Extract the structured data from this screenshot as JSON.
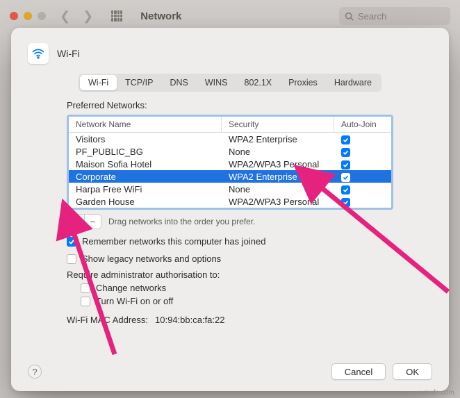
{
  "bg": {
    "title": "Network",
    "search_placeholder": "Search"
  },
  "sheet": {
    "title": "Wi-Fi"
  },
  "tabs": [
    "Wi-Fi",
    "TCP/IP",
    "DNS",
    "WINS",
    "802.1X",
    "Proxies",
    "Hardware"
  ],
  "active_tab": 0,
  "section_label": "Preferred Networks:",
  "columns": {
    "name": "Network Name",
    "security": "Security",
    "autojoin": "Auto-Join"
  },
  "networks": [
    {
      "name": "Visitors",
      "security": "WPA2 Enterprise",
      "autojoin": true,
      "selected": false
    },
    {
      "name": "PF_PUBLIC_BG",
      "security": "None",
      "autojoin": true,
      "selected": false
    },
    {
      "name": "Maison Sofia Hotel",
      "security": "WPA2/WPA3 Personal",
      "autojoin": true,
      "selected": false
    },
    {
      "name": "Corporate",
      "security": "WPA2 Enterprise",
      "autojoin": true,
      "selected": true
    },
    {
      "name": "Harpa Free WiFi",
      "security": "None",
      "autojoin": true,
      "selected": false
    },
    {
      "name": "Garden House",
      "security": "WPA2/WPA3 Personal",
      "autojoin": true,
      "selected": false
    }
  ],
  "drag_hint": "Drag networks into the order you prefer.",
  "options": {
    "remember": {
      "label": "Remember networks this computer has joined",
      "checked": true
    },
    "show_legacy": {
      "label": "Show legacy networks and options",
      "checked": false
    },
    "require_label": "Require administrator authorisation to:",
    "change_networks": {
      "label": "Change networks",
      "checked": false
    },
    "turn_wifi": {
      "label": "Turn Wi-Fi on or off",
      "checked": false
    }
  },
  "mac": {
    "label": "Wi-Fi MAC Address:",
    "value": "10:94:bb:ca:fa:22"
  },
  "buttons": {
    "plus": "+",
    "minus": "−",
    "cancel": "Cancel",
    "ok": "OK",
    "help": "?"
  },
  "watermark": "wsxdn.com"
}
